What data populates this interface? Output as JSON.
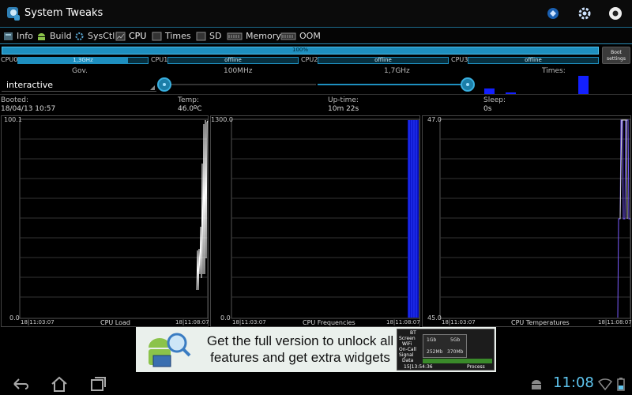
{
  "app": {
    "title": "System Tweaks"
  },
  "tabs": [
    {
      "label": "Info",
      "icon": "info-icon"
    },
    {
      "label": "Build",
      "icon": "android-icon"
    },
    {
      "label": "SysCtl",
      "icon": "gear-icon"
    },
    {
      "label": "CPU",
      "icon": "cpu-icon"
    },
    {
      "label": "Times",
      "icon": "times-icon"
    },
    {
      "label": "SD",
      "icon": "sd-card-icon"
    },
    {
      "label": "Memory",
      "icon": "memory-icon"
    },
    {
      "label": "OOM",
      "icon": "oom-icon"
    }
  ],
  "cpu": {
    "total_label": "100%",
    "boot_settings_label": "Boot settings",
    "cores": [
      {
        "name": "CPU0",
        "value": "1,3GHz",
        "load_fraction": 0.85
      },
      {
        "name": "CPU1",
        "value": "offline",
        "load_fraction": 0
      },
      {
        "name": "CPU2",
        "value": "offline",
        "load_fraction": 0
      },
      {
        "name": "CPU3",
        "value": "offline",
        "load_fraction": 0
      }
    ],
    "headers": {
      "gov": "Gov.",
      "min": "100MHz",
      "max": "1,7GHz",
      "times": "Times:"
    },
    "governor": "interactive",
    "min_slider_fraction": 0.0,
    "max_slider_fraction": 1.0
  },
  "info": {
    "booted_label": "Booted:",
    "booted_value": "18/04/13 10:57",
    "temp_label": "Temp:",
    "temp_value": "46.0ºC",
    "uptime_label": "Up-time:",
    "uptime_value": "10m 22s",
    "sleep_label": "Sleep:",
    "sleep_value": "0s"
  },
  "graphs": [
    {
      "title": "CPU Load",
      "ymax": "100.1",
      "ymin": "0.0",
      "t_start": "18|11:03:07",
      "t_end": "18|11:08:07"
    },
    {
      "title": "CPU Frequencies",
      "ymax": "1300.0",
      "ymin": "0.0",
      "t_start": "18|11:03:07",
      "t_end": "18|11:08:07"
    },
    {
      "title": "CPU Temperatures",
      "ymax": "47.0",
      "ymin": "45.0",
      "t_start": "18|11:03:07",
      "t_end": "18|11:08:07"
    }
  ],
  "ad": {
    "text": "Get the full version to unlock all features and get extra widgets",
    "phone_labels": [
      "BT",
      "Screen",
      "WiFi",
      "On-Call",
      "Signal",
      "Data"
    ],
    "phone_time": "15|13:54:36",
    "phone_process": "Process",
    "phone_chip1": "1Gb",
    "phone_chip2": "5Gb",
    "phone_chip3": "252Mb",
    "phone_chip4": "370Mb"
  },
  "system": {
    "clock": "11:08"
  },
  "colors": {
    "accent": "#1e8fbf",
    "frequency": "#1320ff",
    "temperature": "#7a5cff"
  }
}
